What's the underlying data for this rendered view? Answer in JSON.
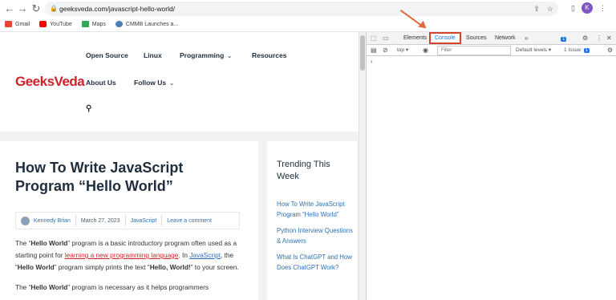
{
  "browser": {
    "url": "geeksveda.com/javascript-hello-world/",
    "avatar_letter": "K",
    "bookmarks": [
      "Gmail",
      "YouTube",
      "Maps",
      "CMMB Launches a..."
    ]
  },
  "site": {
    "logo": "GeeksVeda",
    "menu": [
      "Open Source",
      "Linux",
      "Programming",
      "Resources",
      "About Us",
      "Follow Us"
    ]
  },
  "article": {
    "title": "How To Write JavaScript Program “Hello World”",
    "author": "Kennedy Brian",
    "date": "March 27, 2023",
    "category": "JavaScript",
    "comment_link": "Leave a comment",
    "p1_a": "The “",
    "p1_b": "Hello World",
    "p1_c": "” program is a basic introductory program often used as a starting point for ",
    "p1_link": "learning a new programming language",
    "p1_d": ". In ",
    "p1_link2": "JavaScript",
    "p1_e": ", the “",
    "p1_f": "Hello World",
    "p1_g": "” program simply prints the text “",
    "p1_h": "Hello, World!",
    "p1_i": "” to your screen.",
    "p2_a": "The “",
    "p2_b": "Hello World",
    "p2_c": "” program is necessary as it helps programmers"
  },
  "sidebar": {
    "title": "Trending This Week",
    "links": [
      "How To Write JavaScript Program “Hello World”",
      "Python Interview Questions & Answers",
      "What Is ChatGPT and How Does ChatGPT Work?"
    ]
  },
  "devtools": {
    "tabs": [
      "Elements",
      "Console",
      "Sources",
      "Network"
    ],
    "issue_count": "1",
    "context": "top",
    "filter_placeholder": "Filter",
    "levels": "Default levels",
    "issues_label": "1 Issue:",
    "issues_badge": "1",
    "prompt": "›"
  }
}
